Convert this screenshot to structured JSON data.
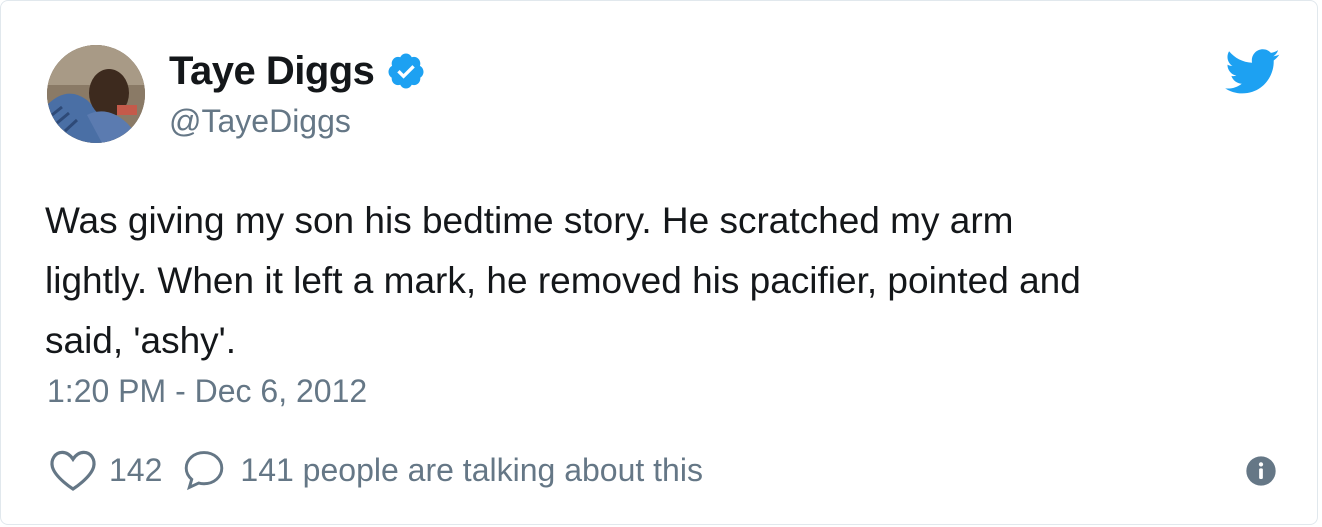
{
  "author": {
    "display_name": "Taye Diggs",
    "handle": "@TayeDiggs",
    "verified_icon": "verified-badge-icon",
    "avatar": "avatar"
  },
  "tweet": {
    "text_lines": [
      "Was giving my son his bedtime story. He scratched my arm",
      "lightly. When it left a mark, he removed his pacifier, pointed and",
      "said, 'ashy'."
    ],
    "timestamp": "1:20 PM - Dec 6, 2012"
  },
  "actions": {
    "like_icon": "heart-icon",
    "like_count": "142",
    "reply_icon": "speech-bubble-icon",
    "talking_text": "141 people are talking about this",
    "info_icon": "info-icon"
  },
  "brand": {
    "logo_icon": "twitter-bird-icon",
    "accent_color": "#1da1f2",
    "text_color": "#14171a",
    "muted_color": "#657786"
  }
}
